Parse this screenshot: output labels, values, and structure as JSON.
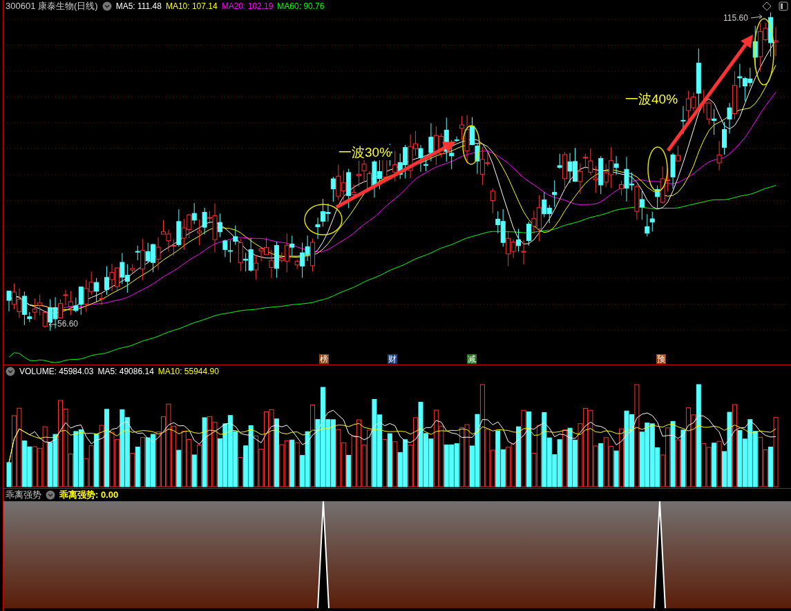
{
  "price_header": {
    "title": "300601 康泰生物(日线)",
    "indicators": [
      {
        "label": "MA5: 111.48",
        "color": "#ffffff"
      },
      {
        "label": "MA10: 107.14",
        "color": "#ffff00"
      },
      {
        "label": "MA20: 102.19",
        "color": "#ff00ff"
      },
      {
        "label": "MA60: 90.76",
        "color": "#00ff00"
      }
    ]
  },
  "price_chart": {
    "high_label": "115.60",
    "low_label": "56.60",
    "annotations": [
      {
        "text": "一波30%"
      },
      {
        "text": "一波40%"
      }
    ],
    "event_markers": [
      {
        "text": "榜",
        "color": "#8b4513"
      },
      {
        "text": "财",
        "color": "#1c3f7a"
      },
      {
        "text": "减",
        "color": "#1d7a1d"
      },
      {
        "text": "预",
        "color": "#a8400c"
      }
    ]
  },
  "volume_header": {
    "indicators": [
      {
        "label": "VOLUME: 45984.03",
        "color": "#ffffff"
      },
      {
        "label": "MA5: 49086.14",
        "color": "#ffffff"
      },
      {
        "label": "MA10: 55944.90",
        "color": "#ffff00"
      }
    ]
  },
  "indicator_header": {
    "title": "乖离强势",
    "indicators": [
      {
        "label": "乖离强势: 0.00",
        "color": "#ffff00"
      }
    ]
  }
}
